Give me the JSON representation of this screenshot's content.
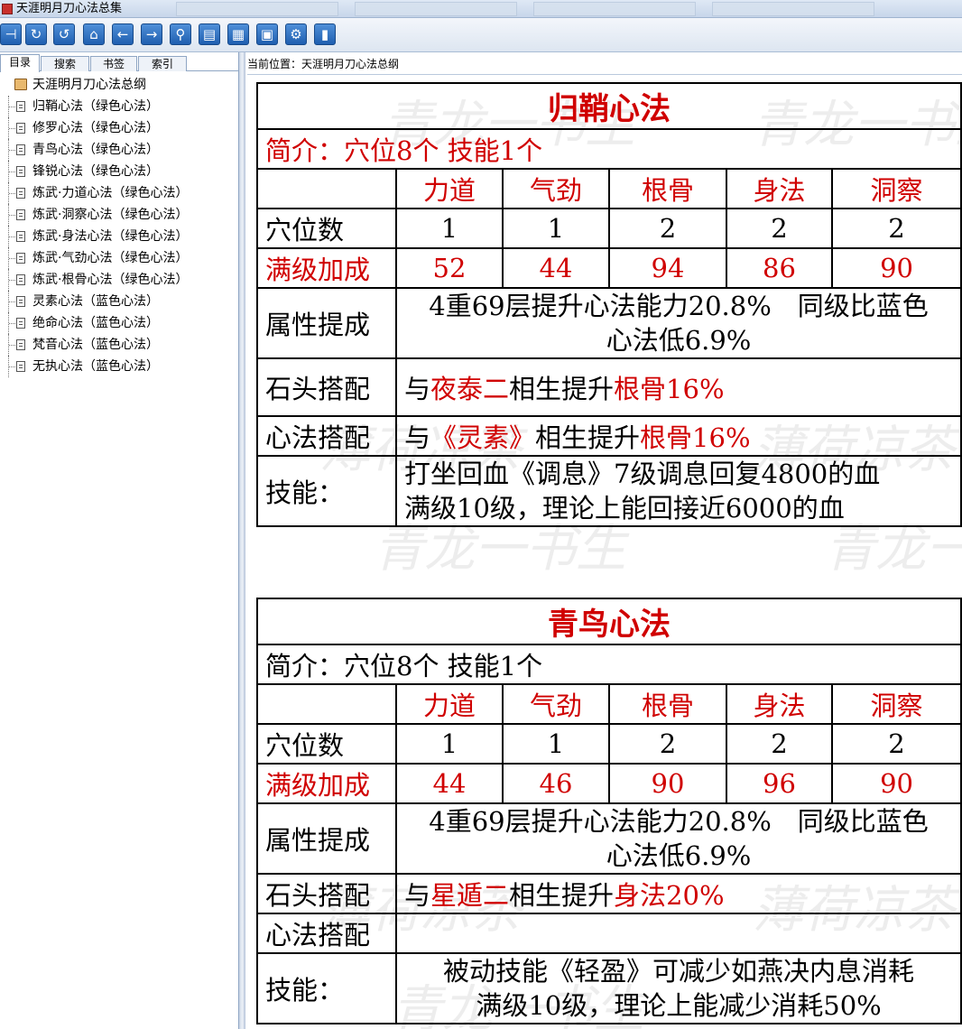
{
  "window": {
    "title": "天涯明月刀心法总集"
  },
  "toolbar": {
    "buttons": [
      "show-tree",
      "refresh",
      "undo",
      "home",
      "back",
      "forward",
      "search",
      "print",
      "notes",
      "export",
      "settings",
      "exit"
    ]
  },
  "left_panel": {
    "tabs": [
      "目录",
      "搜索",
      "书签",
      "索引"
    ],
    "active_tab": "目录",
    "tree_items": [
      "天涯明月刀心法总纲",
      "归鞘心法（绿色心法）",
      "修罗心法（绿色心法）",
      "青鸟心法（绿色心法）",
      "锋锐心法（绿色心法）",
      "炼武·力道心法（绿色心法）",
      "炼武·洞察心法（绿色心法）",
      "炼武·身法心法（绿色心法）",
      "炼武·气劲心法（绿色心法）",
      "炼武·根骨心法（绿色心法）",
      "灵素心法（蓝色心法）",
      "绝命心法（蓝色心法）",
      "梵音心法（蓝色心法）",
      "无执心法（蓝色心法）"
    ]
  },
  "location": {
    "text": "当前位置：天涯明月刀心法总纲"
  },
  "watermarks": [
    "青龙一书生",
    "薄荷凉茶"
  ],
  "articles": [
    {
      "title": "归鞘心法",
      "intro": "简介：穴位8个 技能1个",
      "attr_headers": [
        "力道",
        "气劲",
        "根骨",
        "身法",
        "洞察"
      ],
      "row_points_label": "穴位数",
      "points": [
        "1",
        "1",
        "2",
        "2",
        "2"
      ],
      "row_bonus_label": "满级加成",
      "bonus": [
        "52",
        "44",
        "94",
        "86",
        "90"
      ],
      "attr_label": "属性提成",
      "attr_line1": "4重69层提升心法能力20.8%　同级比蓝色",
      "attr_line2": "心法低6.9%",
      "stone_label": "石头搭配",
      "stone_pre": "与",
      "stone_name": "夜泰二",
      "stone_mid": "相生提升",
      "stone_bonus": "根骨16%",
      "heart_label": "心法搭配",
      "heart_pre": "与",
      "heart_name": "《灵素》",
      "heart_mid": "相生提升",
      "heart_bonus": "根骨16%",
      "skill_label": "技能：",
      "skill_line1": "打坐回血《调息》7级调息回复4800的血",
      "skill_line2": "满级10级，理论上能回接近6000的血"
    },
    {
      "title": "青鸟心法",
      "intro": "简介：穴位8个 技能1个",
      "attr_headers": [
        "力道",
        "气劲",
        "根骨",
        "身法",
        "洞察"
      ],
      "row_points_label": "穴位数",
      "points": [
        "1",
        "1",
        "2",
        "2",
        "2"
      ],
      "row_bonus_label": "满级加成",
      "bonus": [
        "44",
        "46",
        "90",
        "96",
        "90"
      ],
      "attr_label": "属性提成",
      "attr_line1": "4重69层提升心法能力20.8%　同级比蓝色",
      "attr_line2": "心法低6.9%",
      "stone_label": "石头搭配",
      "stone_pre": "与",
      "stone_name": "星遁二",
      "stone_mid": "相生提升",
      "stone_bonus": "身法20%",
      "heart_label": "心法搭配",
      "skill_label": "技能：",
      "skill_line1": "被动技能《轻盈》可减少如燕决内息消耗",
      "skill_line2": "满级10级，理论上能减少消耗50%"
    }
  ],
  "colors": {
    "accent_red": "#d00000",
    "toolbar_button": "#1f5fb0"
  }
}
